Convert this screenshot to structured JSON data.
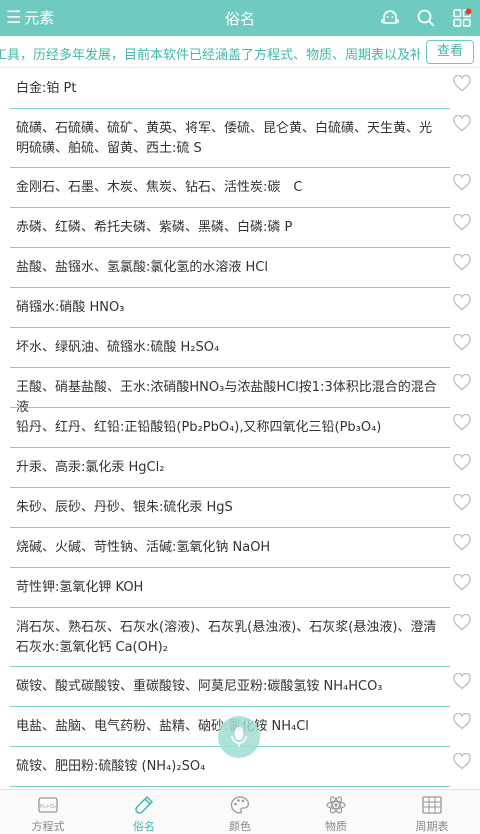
{
  "header": {
    "menu_label": "元素",
    "title": "俗名",
    "icons": [
      "android-icon",
      "search-icon",
      "grid-apps-icon"
    ],
    "notification_dot_color": "#e53935"
  },
  "notice": {
    "text": "工具，历经多年发展，目前本软件已经涵盖了方程式、物质、周期表以及补充资料",
    "button_label": "查看"
  },
  "items": [
    "白金:铂 Pt",
    "硫磺、石硫磺、硫矿、黄英、将军、倭硫、昆仑黄、白硫磺、天生黄、光明硫磺、舶硫、留黄、西土:硫 S",
    "金刚石、石墨、木炭、焦炭、钻石、活性炭:碳　C",
    "赤磷、红磷、希托夫磷、紫磷、黑磷、白磷:磷 P",
    "盐酸、盐镪水、氢氯酸:氯化氢的水溶液 HCl",
    "硝镪水:硝酸 HNO₃",
    "坏水、绿矾油、硫镪水:硫酸 H₂SO₄",
    "王酸、硝基盐酸、王水:浓硝酸HNO₃与浓盐酸HCl按1:3体积比混合的混合液",
    "铅丹、红丹、红铅:正铅酸铅(Pb₂PbO₄),又称四氧化三铅(Pb₃O₄)",
    "升汞、高汞:氯化汞 HgCl₂",
    "朱砂、辰砂、丹砂、银朱:硫化汞 HgS",
    "烧碱、火碱、苛性钠、活碱:氢氧化钠 NaOH",
    "苛性钾:氢氧化钾 KOH",
    "消石灰、熟石灰、石灰水(溶液)、石灰乳(悬浊液)、石灰浆(悬浊液)、澄清石灰水:氢氧化钙 Ca(OH)₂",
    "碳铵、酸式碳酸铵、重碳酸铵、阿莫尼亚粉:碳酸氢铵 NH₄HCO₃",
    "电盐、盐脑、电气药粉、盐精、硇砂:氯化铵 NH₄Cl",
    "硫铵、肥田粉:硫酸铵 (NH₄)₂SO₄"
  ],
  "tabs": [
    {
      "label": "方程式",
      "icon": "equation-icon"
    },
    {
      "label": "俗名",
      "icon": "test-tube-icon"
    },
    {
      "label": "颜色",
      "icon": "palette-icon"
    },
    {
      "label": "物质",
      "icon": "atom-icon"
    },
    {
      "label": "周期表",
      "icon": "periodic-table-icon"
    }
  ],
  "active_tab": "俗名",
  "colors": {
    "accent": "#6fcbbf",
    "accent_text": "#3fb8a8",
    "divider": "#7fd1c6"
  }
}
